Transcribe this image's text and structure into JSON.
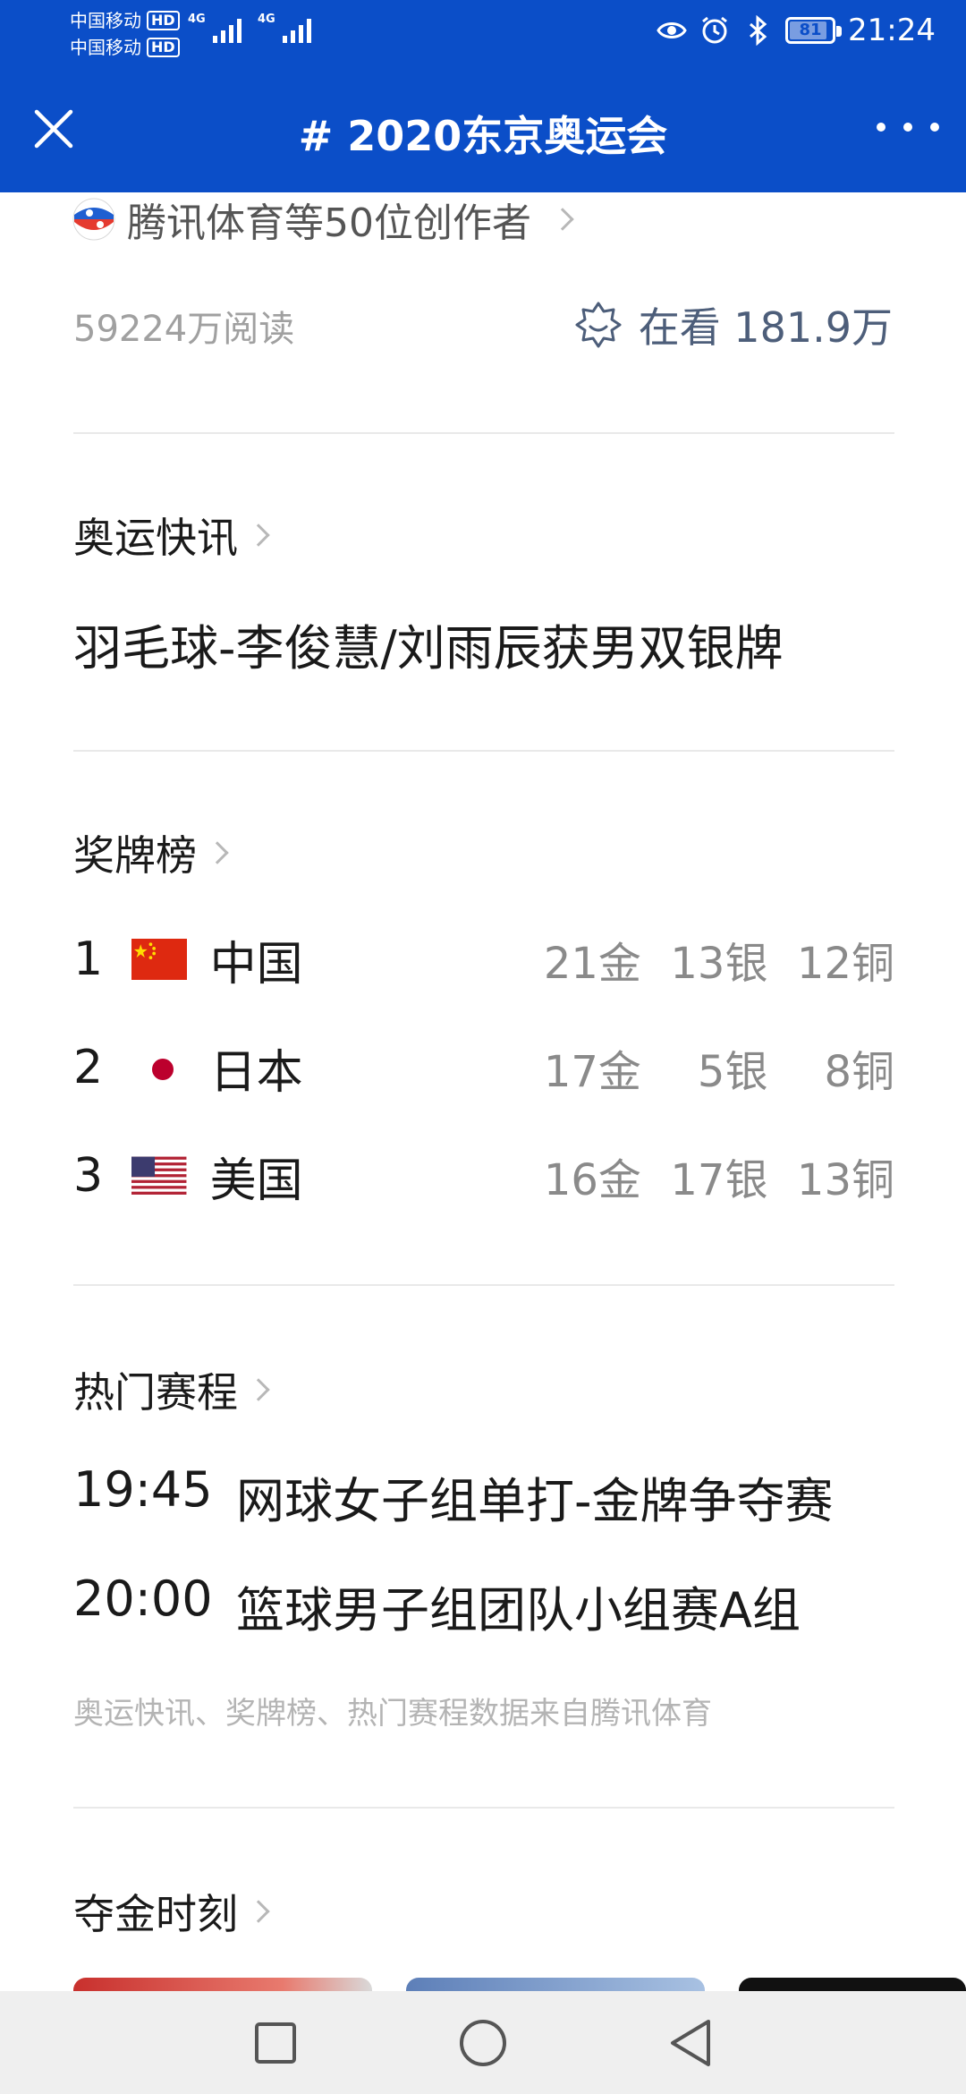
{
  "status_bar": {
    "carrier1": "中国移动",
    "carrier2": "中国移动",
    "hd": "HD",
    "net1": "4G",
    "net2": "4G",
    "battery": "81",
    "time": "21:24"
  },
  "nav": {
    "title": "# 2020东京奥运会"
  },
  "header": {
    "creators": "腾讯体育等50位创作者",
    "reads": "59224万阅读",
    "watching": "在看 181.9万"
  },
  "flash": {
    "title": "奥运快讯",
    "headline": "羽毛球-李俊慧/刘雨辰获男双银牌"
  },
  "medals": {
    "title": "奖牌榜",
    "rows": [
      {
        "rank": "1",
        "country": "中国",
        "gold": "21金",
        "silver": "13银",
        "bronze": "12铜"
      },
      {
        "rank": "2",
        "country": "日本",
        "gold": "17金",
        "silver": "5银",
        "bronze": "8铜"
      },
      {
        "rank": "3",
        "country": "美国",
        "gold": "16金",
        "silver": "17银",
        "bronze": "13铜"
      }
    ]
  },
  "schedule": {
    "title": "热门赛程",
    "items": [
      {
        "time": "19:45",
        "event": "网球女子组单打-金牌争夺赛"
      },
      {
        "time": "20:00",
        "event": "篮球男子组团队小组赛A组"
      }
    ],
    "note": "奥运快讯、奖牌榜、热门赛程数据来自腾讯体育"
  },
  "moments": {
    "title": "夺金时刻"
  },
  "colors": {
    "brand_blue": "#0b4ec8",
    "muted_gray": "#8a8a8a"
  }
}
